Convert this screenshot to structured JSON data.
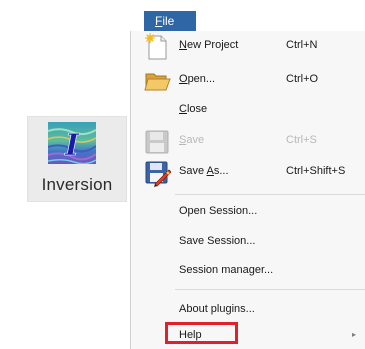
{
  "launcher": {
    "label": "Inversion",
    "icon": "inversion-app-icon",
    "icon_letter": "I"
  },
  "menubar": {
    "file_prefix": "",
    "file_accel": "F",
    "file_rest": "ile"
  },
  "menu": {
    "new_project": {
      "pre": "",
      "accel": "N",
      "post": "ew Project",
      "shortcut": "Ctrl+N",
      "icon": "new-document-icon"
    },
    "open": {
      "pre": "",
      "accel": "O",
      "post": "pen...",
      "shortcut": "Ctrl+O",
      "icon": "folder-open-icon"
    },
    "close": {
      "pre": "",
      "accel": "C",
      "post": "lose"
    },
    "save": {
      "pre": "",
      "accel": "S",
      "post": "ave",
      "shortcut": "Ctrl+S",
      "icon": "floppy-disk-icon",
      "disabled": true
    },
    "save_as": {
      "pre": "Save ",
      "accel": "A",
      "post": "s...",
      "shortcut": "Ctrl+Shift+S",
      "icon": "save-as-icon"
    },
    "open_session": {
      "label": "Open Session..."
    },
    "save_session": {
      "label": "Save Session..."
    },
    "session_manager": {
      "label": "Session manager..."
    },
    "about_plugins": {
      "label": "About plugins..."
    },
    "help": {
      "label": "Help",
      "has_submenu": true,
      "arrow": "▸"
    }
  },
  "colors": {
    "menubar_active": "#2f66a6",
    "highlight_box": "#e0202a",
    "menu_bg": "#f7f7f7"
  }
}
